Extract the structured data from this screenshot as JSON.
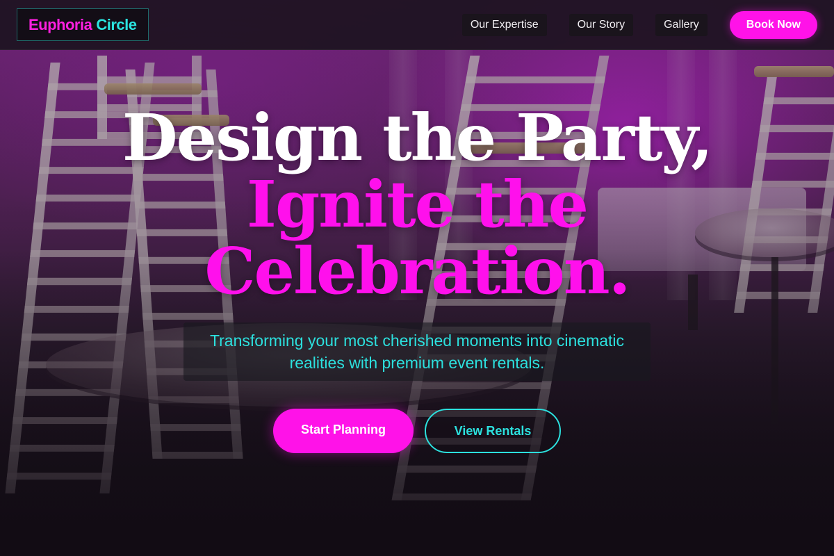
{
  "brand": {
    "name_part1": "Euphoria",
    "name_part2": "Circle"
  },
  "nav": {
    "links": [
      "Our Expertise",
      "Our Story",
      "Gallery"
    ],
    "cta_label": "Book Now"
  },
  "hero": {
    "headline_line1": "Design the Party,",
    "headline_line2": "Ignite the",
    "headline_line3": "Celebration.",
    "subtitle": "Transforming your most cherished moments into cinematic realities with premium event rentals.",
    "primary_cta": "Start Planning",
    "secondary_cta": "View Rentals"
  },
  "colors": {
    "accent_pink": "#ff12e8",
    "accent_cyan": "#2ce0de",
    "header_bg": "#1c1420"
  }
}
